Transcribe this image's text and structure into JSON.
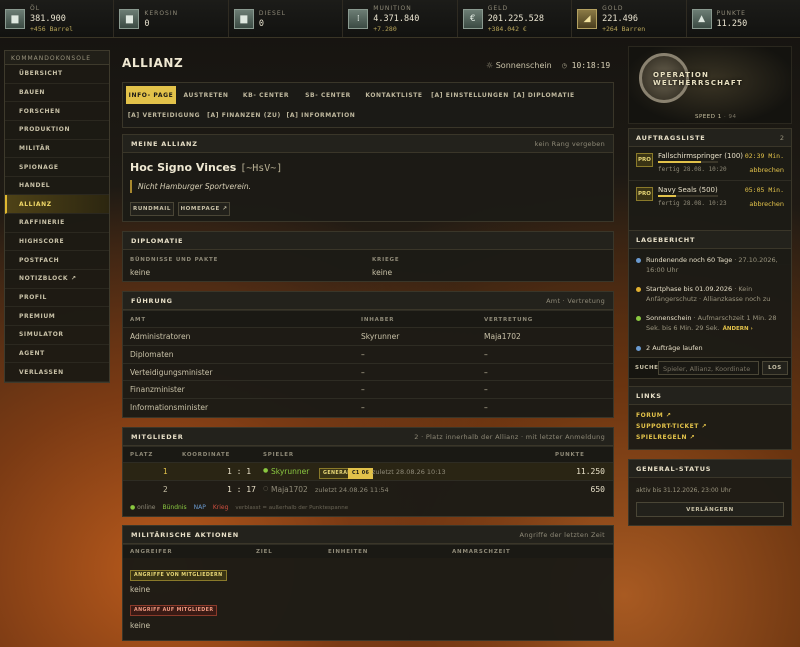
{
  "resources": [
    {
      "label": "ÖL",
      "value": "381.900",
      "sub": "+456 Barrel",
      "icon": "oil-barrel-icon",
      "glyph": "▆",
      "gold": false
    },
    {
      "label": "KEROSIN",
      "value": "0",
      "sub": "",
      "icon": "kerosene-icon",
      "glyph": "▆",
      "gold": false
    },
    {
      "label": "DIESEL",
      "value": "0",
      "sub": "",
      "icon": "diesel-icon",
      "glyph": "▆",
      "gold": false
    },
    {
      "label": "MUNITION",
      "value": "4.371.840",
      "sub": "+7.280",
      "icon": "ammunition-icon",
      "glyph": "⁞",
      "gold": false
    },
    {
      "label": "GELD",
      "value": "201.225.528",
      "sub": "+384.042 €",
      "icon": "money-icon",
      "glyph": "€",
      "gold": false
    },
    {
      "label": "GOLD",
      "value": "221.496",
      "sub": "+264 Barren",
      "icon": "gold-bar-icon",
      "glyph": "◢",
      "gold": true
    },
    {
      "label": "PUNKTE",
      "value": "11.250",
      "sub": "",
      "icon": "points-icon",
      "glyph": "▲",
      "gold": false
    }
  ],
  "sidebar": {
    "title": "KOMMANDOKONSOLE",
    "items": [
      "Übersicht",
      "Bauen",
      "Forschen",
      "Produktion",
      "Militär",
      "Spionage",
      "Handel",
      "Allianz",
      "Raffinerie",
      "Highscore",
      "Postfach",
      "Notizblock ↗",
      "Profil",
      "Premium",
      "Simulator",
      "Agent",
      "Verlassen"
    ],
    "active_index": 7
  },
  "page": {
    "title": "ALLIANZ",
    "weather": "Sonnenschein",
    "time": "10:18:19"
  },
  "tabs": [
    "INFO- PAGE",
    "AUSTRETEN",
    "KB- CENTER",
    "SB- CENTER",
    "KONTAKTLISTE",
    "[A] EINSTELLUNGEN",
    "[A] DIPLOMATIE",
    "[A] VERTEIDIGUNG",
    "[A] FINANZEN (ZU)",
    "[A] INFORMATION"
  ],
  "alliance": {
    "section": "MEINE ALLIANZ",
    "rank_note": "kein Rang vergeben",
    "name": "Hoc Signo Vinces",
    "tag": "[~HsV~]",
    "motto": "Nicht Hamburger Sportverein.",
    "btn_rundmail": "RUNDMAIL",
    "btn_homepage": "HOMEPAGE ↗"
  },
  "diplomacy": {
    "title": "DIPLOMATIE",
    "col1": "BÜNDNISSE UND PAKTE",
    "col2": "KRIEGE",
    "val1": "keine",
    "val2": "keine"
  },
  "leadership": {
    "title": "FÜHRUNG",
    "note": "Amt · Vertretung",
    "headers": [
      "AMT",
      "INHABER",
      "VERTRETUNG"
    ],
    "rows": [
      [
        "Administratoren",
        "Skyrunner",
        "Maja1702"
      ],
      [
        "Diplomaten",
        "–",
        "–"
      ],
      [
        "Verteidigungsminister",
        "–",
        "–"
      ],
      [
        "Finanzminister",
        "–",
        "–"
      ],
      [
        "Informationsminister",
        "–",
        "–"
      ]
    ]
  },
  "members": {
    "title": "MITGLIEDER",
    "note": "2 · Platz innerhalb der Allianz · mit letzter Anmeldung",
    "headers": [
      "PLATZ",
      "KOORDINATE",
      "SPIELER",
      "PUNKTE"
    ],
    "rows": [
      {
        "rank": "1",
        "coord": "1 : 1",
        "name": "Skyrunner",
        "badge1": "GENERAL",
        "badge2": "C1 06",
        "last": "zuletzt 28.08.26 10:13",
        "points": "11.250"
      },
      {
        "rank": "2",
        "coord": "1 : 17",
        "name": "Maja1702",
        "badge1": "",
        "badge2": "",
        "last": "zuletzt 24.08.26 11:54",
        "points": "650"
      }
    ],
    "legend": {
      "online": "online",
      "ally": "Bündnis",
      "nap": "NAP",
      "war": "Krieg",
      "out": "verblasst = außerhalb der Punktespanne"
    }
  },
  "military": {
    "title": "MILITÄRISCHE AKTIONEN",
    "note": "Angriffe der letzten Zeit",
    "headers": [
      "ANGREIFER",
      "ZIEL",
      "EINHEITEN",
      "ANMARSCHZEIT"
    ],
    "tag1": "ANGRIFFE VON MITGLIEDERN",
    "val1": "keine",
    "tag2": "ANGRIFF AUF MITGLIEDER",
    "val2": "keine"
  },
  "logo": {
    "text": "OPERATION WELTHERRSCHAFT",
    "speed_label": "SPEED 1",
    "speed_sub": "· 94"
  },
  "orders": {
    "title": "AUFTRAGSLISTE",
    "count": "2",
    "items": [
      {
        "badge": "PRO",
        "name": "Fallschirmspringer (100)",
        "time": "02:39 Min.",
        "done": "fertig 28.08. 10:20",
        "cancel": "abbrechen",
        "progress": 0.72
      },
      {
        "badge": "PRO",
        "name": "Navy Seals (500)",
        "time": "05:05 Min.",
        "done": "fertig 28.08. 10:23",
        "cancel": "abbrechen",
        "progress": 0.3
      }
    ]
  },
  "report": {
    "title": "LAGEBERICHT",
    "items": [
      {
        "color": "#6a9ad0",
        "bold": "Rundenende noch 60 Tage",
        "rest": " · 27.10.2026, 16:00 Uhr"
      },
      {
        "color": "#e2b030",
        "bold": "Startphase bis 01.09.2026",
        "rest": " · Kein Anfängerschutz · Allianzkasse noch zu"
      },
      {
        "color": "#8ac840",
        "bold": "Sonnenschein",
        "rest": " · Aufmarschzeit 1 Min. 28 Sek. bis 6 Min. 29 Sek.",
        "link": "ÄNDERN ›"
      },
      {
        "color": "#6a9ad0",
        "bold": "2 Aufträge laufen",
        "rest": ""
      }
    ]
  },
  "search": {
    "label": "SUCHE",
    "placeholder": "Spieler, Allianz, Koordinate",
    "button": "LOS"
  },
  "links": {
    "title": "LINKS",
    "items": [
      "FORUM ↗",
      "SUPPORT-TICKET ↗",
      "SPIELREGELN ↗"
    ]
  },
  "general_status": {
    "title": "GENERAL-STATUS",
    "text": "aktiv bis 31.12.2026, 23:00 Uhr",
    "button": "VERLÄNGERN"
  },
  "colors": {
    "accent": "#e2c24a",
    "bg_panel": "#1c1b16",
    "online": "#8ac840",
    "nap": "#6a9ad0",
    "war": "#d05040"
  }
}
